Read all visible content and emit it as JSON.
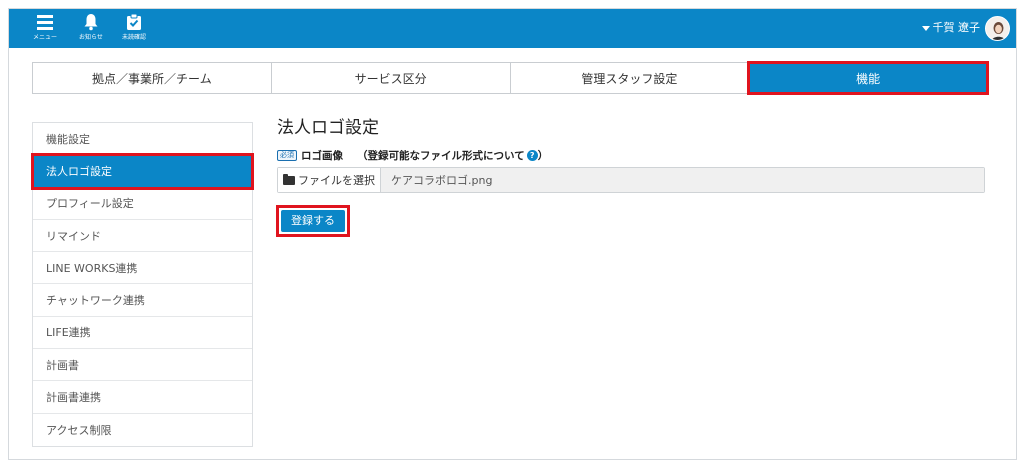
{
  "colors": {
    "brand": "#0b86c7",
    "highlight": "#e0141e"
  },
  "topbar": {
    "items": [
      {
        "label": "メニュー",
        "icon": "menu-icon"
      },
      {
        "label": "お知らせ",
        "icon": "bell-icon"
      },
      {
        "label": "未読確認",
        "icon": "clipboard-check-icon"
      }
    ],
    "user_name": "千賀 遼子",
    "user_avatar": "avatar"
  },
  "tabs": [
    {
      "label": "拠点／事業所／チーム"
    },
    {
      "label": "サービス区分"
    },
    {
      "label": "管理スタッフ設定"
    },
    {
      "label": "機能",
      "active": true
    }
  ],
  "sidebar": {
    "items": [
      {
        "label": "機能設定"
      },
      {
        "label": "法人ロゴ設定",
        "active": true
      },
      {
        "label": "プロフィール設定"
      },
      {
        "label": "リマインド"
      },
      {
        "label": "LINE WORKS連携"
      },
      {
        "label": "チャットワーク連携"
      },
      {
        "label": "LIFE連携"
      },
      {
        "label": "計画書"
      },
      {
        "label": "計画書連携"
      },
      {
        "label": "アクセス制限"
      }
    ]
  },
  "main": {
    "title": "法人ロゴ設定",
    "required_badge": "必須",
    "field_label": "ロゴ画像",
    "help_link": "（登録可能なファイル形式について",
    "help_close": "）",
    "pick_button": "ファイルを選択",
    "file_name": "ケアコラボロゴ.png",
    "submit_label": "登録する"
  }
}
